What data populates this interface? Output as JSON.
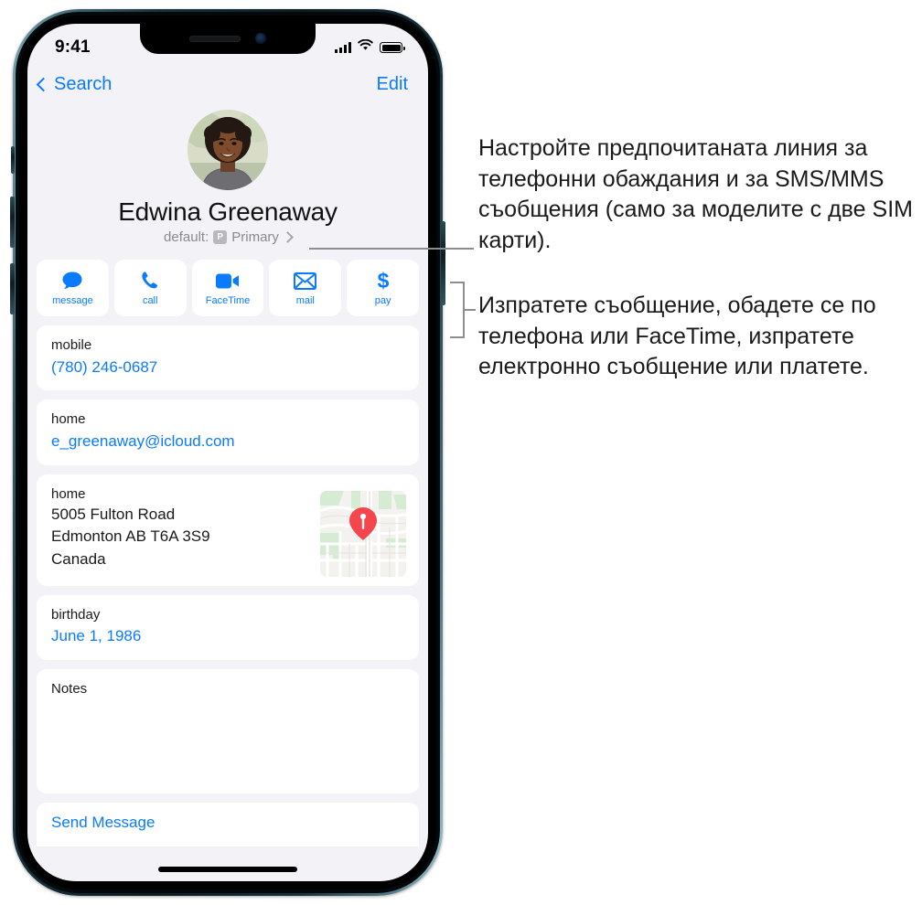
{
  "statusbar": {
    "time": "9:41",
    "cellular_icon": "cellular-bars-icon",
    "wifi_icon": "wifi-icon",
    "battery_icon": "battery-full-icon"
  },
  "navbar": {
    "back_label": "Search",
    "back_icon": "chevron-left-icon",
    "edit_label": "Edit"
  },
  "contact": {
    "avatar_icon": "contact-photo",
    "name": "Edwina Greenaway",
    "default_prefix": "default:",
    "default_badge": "P",
    "default_line": "Primary",
    "default_chevron_icon": "chevron-right-icon"
  },
  "actions": [
    {
      "label": "message",
      "icon": "message-bubble-icon"
    },
    {
      "label": "call",
      "icon": "phone-handset-icon"
    },
    {
      "label": "FaceTime",
      "icon": "video-camera-icon"
    },
    {
      "label": "mail",
      "icon": "envelope-icon"
    },
    {
      "label": "pay",
      "icon": "dollar-sign-icon"
    }
  ],
  "fields": {
    "phone": {
      "label": "mobile",
      "value": "(780) 246-0687"
    },
    "email": {
      "label": "home",
      "value": "e_greenaway@icloud.com"
    },
    "address": {
      "label": "home",
      "line1": "5005 Fulton Road",
      "line2": "Edmonton AB T6A 3S9",
      "line3": "Canada",
      "map_icon": "map-thumbnail-with-pin"
    },
    "birthday": {
      "label": "birthday",
      "value": "June 1, 1986"
    },
    "notes": {
      "label": "Notes",
      "value": ""
    }
  },
  "footer": {
    "send_message_label": "Send Message",
    "home_indicator_icon": "home-indicator"
  },
  "callouts": {
    "sim": "Настройте предпочитаната линия за телефонни обаждания и за SMS/MMS съобщения (само за моделите с две SIM карти).",
    "actions": "Изпратете съобщение, обадете се по телефона или FaceTime, изпратете електронно съобщение или платете."
  },
  "colors": {
    "accent_blue": "#0a7bff",
    "screen_bg": "#f2f2f7",
    "card_bg": "#ffffff",
    "secondary_text": "#8a8a8e",
    "pin_red": "#f4464c",
    "leader_gray": "#8e8e8e"
  }
}
